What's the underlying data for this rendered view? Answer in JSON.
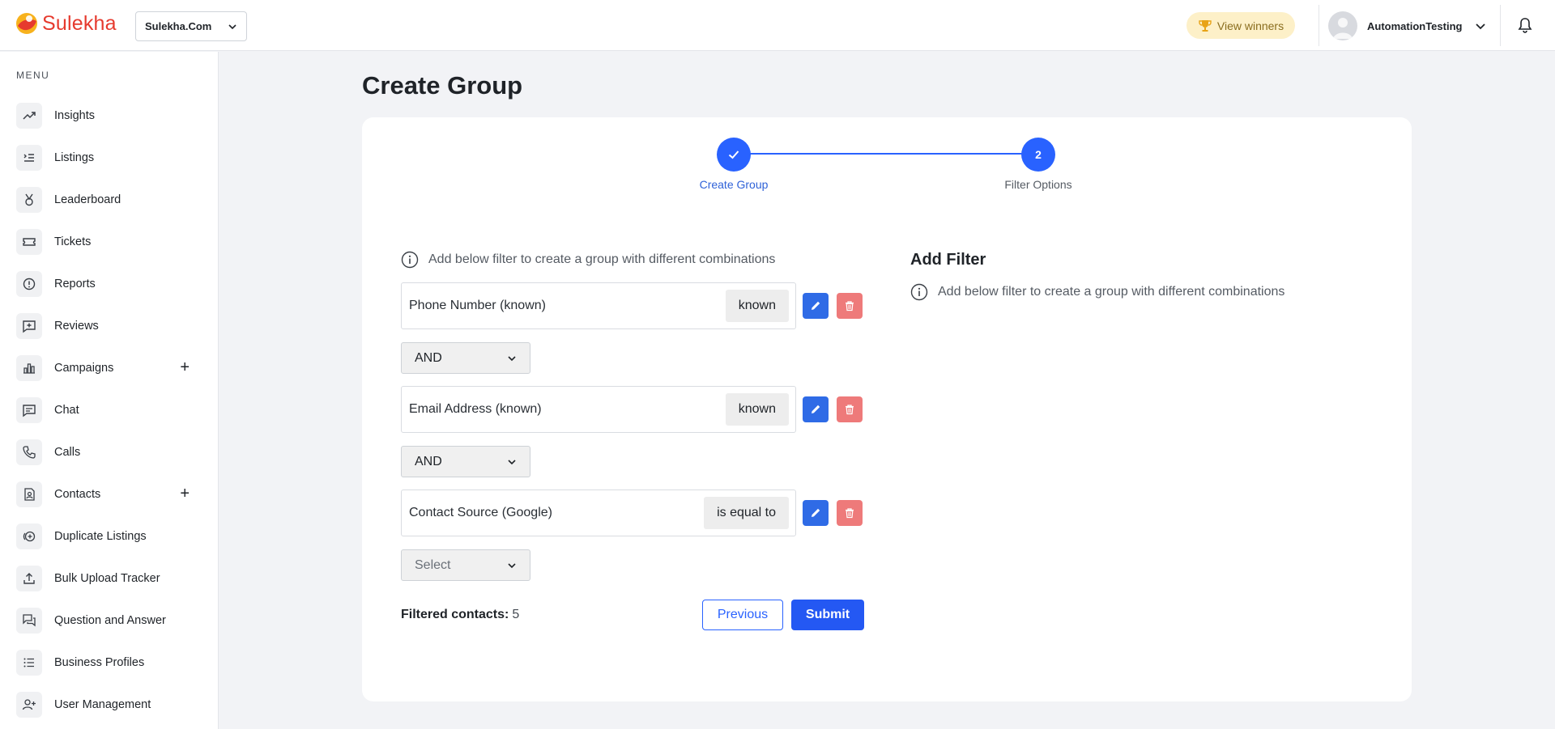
{
  "header": {
    "logo_text": "Sulekha",
    "org_select": "Sulekha.Com",
    "view_winners": "View winners",
    "user_name": "AutomationTesting"
  },
  "sidebar": {
    "menu_label": "MENU",
    "items": [
      {
        "label": "Insights",
        "icon": "trend-icon"
      },
      {
        "label": "Listings",
        "icon": "listings-icon"
      },
      {
        "label": "Leaderboard",
        "icon": "medal-icon"
      },
      {
        "label": "Tickets",
        "icon": "ticket-icon"
      },
      {
        "label": "Reports",
        "icon": "alert-circle-icon"
      },
      {
        "label": "Reviews",
        "icon": "review-icon"
      },
      {
        "label": "Campaigns",
        "icon": "bar-chart-icon",
        "expandable": true
      },
      {
        "label": "Chat",
        "icon": "chat-icon"
      },
      {
        "label": "Calls",
        "icon": "phone-icon"
      },
      {
        "label": "Contacts",
        "icon": "contact-icon",
        "expandable": true
      },
      {
        "label": "Duplicate Listings",
        "icon": "duplicate-icon"
      },
      {
        "label": "Bulk Upload Tracker",
        "icon": "upload-icon"
      },
      {
        "label": "Question and Answer",
        "icon": "qa-icon"
      },
      {
        "label": "Business Profiles",
        "icon": "list-icon"
      },
      {
        "label": "User Management",
        "icon": "user-add-icon"
      }
    ]
  },
  "main": {
    "title": "Create Group",
    "steps": [
      {
        "label": "Create Group",
        "state": "completed"
      },
      {
        "label": "Filter Options",
        "number": "2",
        "state": "active"
      }
    ],
    "info_text": "Add below filter to create a group with different combinations",
    "filters": [
      {
        "text": "Phone Number (known)",
        "operator": "known"
      },
      {
        "text": "Email Address (known)",
        "operator": "known"
      },
      {
        "text": "Contact Source (Google)",
        "operator": "is equal to"
      }
    ],
    "connectors": [
      "AND",
      "AND"
    ],
    "next_connector_placeholder": "Select",
    "filtered_label": "Filtered contacts:",
    "filtered_count": "5",
    "previous_label": "Previous",
    "submit_label": "Submit",
    "add_filter_title": "Add Filter",
    "add_filter_info": "Add below filter to create a group with different combinations"
  },
  "colors": {
    "primary": "#2962ff",
    "brand": "#e63a2e",
    "danger": "#ee7a7a",
    "winners_bg": "#fdf0c8"
  }
}
